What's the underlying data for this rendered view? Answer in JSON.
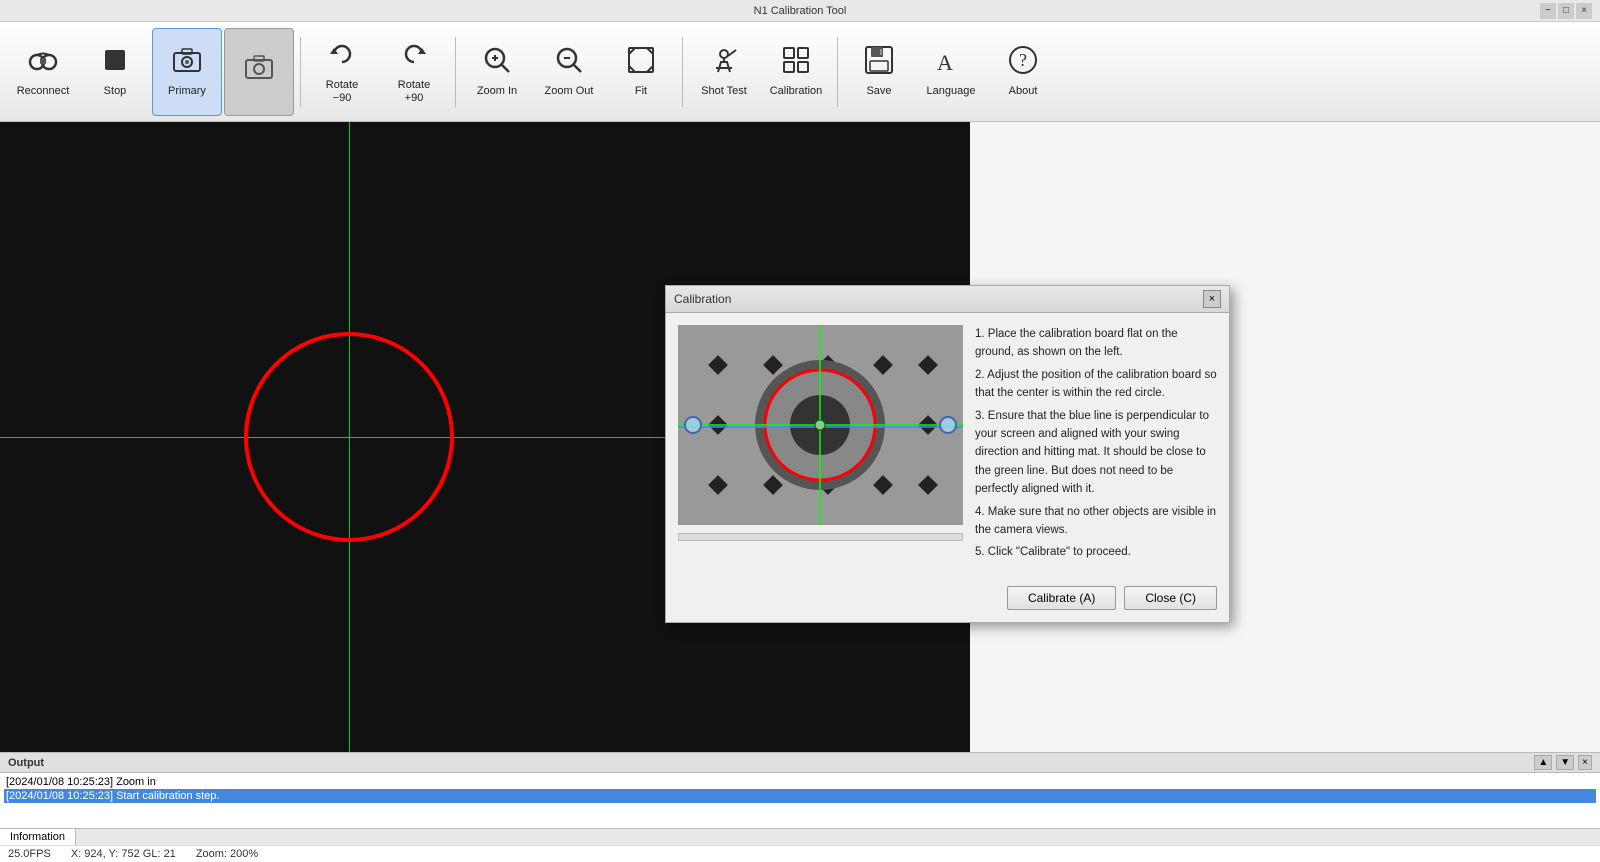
{
  "app": {
    "title": "N1 Calibration Tool"
  },
  "titlebar": {
    "minimize_label": "−",
    "maximize_label": "□",
    "close_label": "×"
  },
  "toolbar": {
    "buttons": [
      {
        "id": "reconnect",
        "label": "Reconnect",
        "icon": "binoculars"
      },
      {
        "id": "stop",
        "label": "Stop",
        "icon": "stop"
      },
      {
        "id": "primary",
        "label": "Primary",
        "icon": "camera",
        "active": true
      },
      {
        "id": "secondary",
        "label": "",
        "icon": "secondary",
        "secondary_active": true
      },
      {
        "id": "rotate_neg90",
        "label": "Rotate\n−90",
        "icon": "rotate-left"
      },
      {
        "id": "rotate_pos90",
        "label": "Rotate\n+90",
        "icon": "rotate-right"
      },
      {
        "id": "zoom_in",
        "label": "Zoom In",
        "icon": "zoom-in"
      },
      {
        "id": "zoom_out",
        "label": "Zoom Out",
        "icon": "zoom-out"
      },
      {
        "id": "fit",
        "label": "Fit",
        "icon": "fit"
      },
      {
        "id": "shot_test",
        "label": "Shot Test",
        "icon": "shot-test"
      },
      {
        "id": "calibration",
        "label": "Calibration",
        "icon": "calibration"
      },
      {
        "id": "save",
        "label": "Save",
        "icon": "save"
      },
      {
        "id": "language",
        "label": "Language",
        "icon": "language"
      },
      {
        "id": "about",
        "label": "About",
        "icon": "about"
      }
    ]
  },
  "camera": {
    "background": "#111"
  },
  "calibration_dialog": {
    "title": "Calibration",
    "instructions": [
      "1. Place the calibration board flat on the ground, as shown on the left.",
      "2. Adjust the position of the calibration board so that the center is within the red circle.",
      "3. Ensure that the blue line is perpendicular to your screen and aligned with your swing direction and hitting mat. It should be close to the green line. But does not need to be perfectly aligned with it.",
      "4. Make sure that no other objects are visible in the camera views.",
      "5. Click \"Calibrate\" to proceed."
    ],
    "calibrate_btn": "Calibrate (A)",
    "close_btn": "Close (C)"
  },
  "output": {
    "title": "Output",
    "logs": [
      {
        "text": "[2024/01/08 10:25:23]  Zoom in",
        "highlighted": false
      },
      {
        "text": "[2024/01/08 10:25:23]  Start calibration step.",
        "highlighted": true
      }
    ],
    "tabs": [
      {
        "label": "Information",
        "active": true
      }
    ],
    "status": {
      "fps": "25.0FPS",
      "coords": "X: 924, Y: 752  GL: 21",
      "zoom": "Zoom: 200%"
    }
  }
}
